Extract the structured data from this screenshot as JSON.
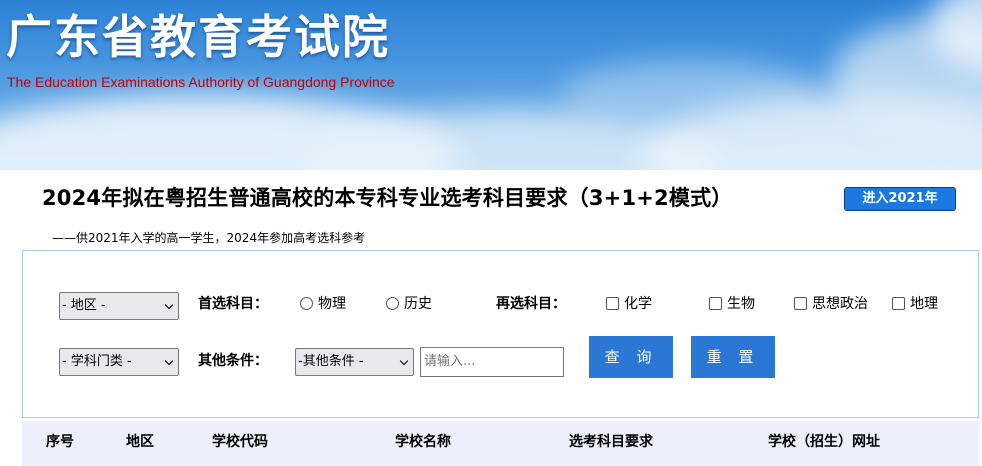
{
  "banner": {
    "title": "广东省教育考试院",
    "subtitle": "The Education Examinations Authority of Guangdong Province"
  },
  "page": {
    "title": "2024年拟在粤招生普通高校的本专科专业选考科目要求（3+1+2模式）",
    "year_button": "进入2021年",
    "note": "——供2021年入学的高一学生，2024年参加高考选科参考"
  },
  "filters": {
    "region_select": "- 地区 -",
    "category_select": "- 学科门类 -",
    "first_subject_label": "首选科目：",
    "first_subject_options": [
      "物理",
      "历史"
    ],
    "second_subject_label": "再选科目：",
    "second_subject_options": [
      "化学",
      "生物",
      "思想政治",
      "地理"
    ],
    "other_label": "其他条件：",
    "other_select": "-其他条件 -",
    "search_placeholder": "请输入...",
    "query_button": "查 询",
    "reset_button": "重 置"
  },
  "table": {
    "columns": [
      "序号",
      "地区",
      "学校代码",
      "学校名称",
      "选考科目要求",
      "学校（招生）网址"
    ]
  },
  "colors": {
    "accent": "#2a78d4",
    "year_button": "#1a78e0",
    "subtitle": "#c80000",
    "table_header_bg": "#eeeefc"
  }
}
